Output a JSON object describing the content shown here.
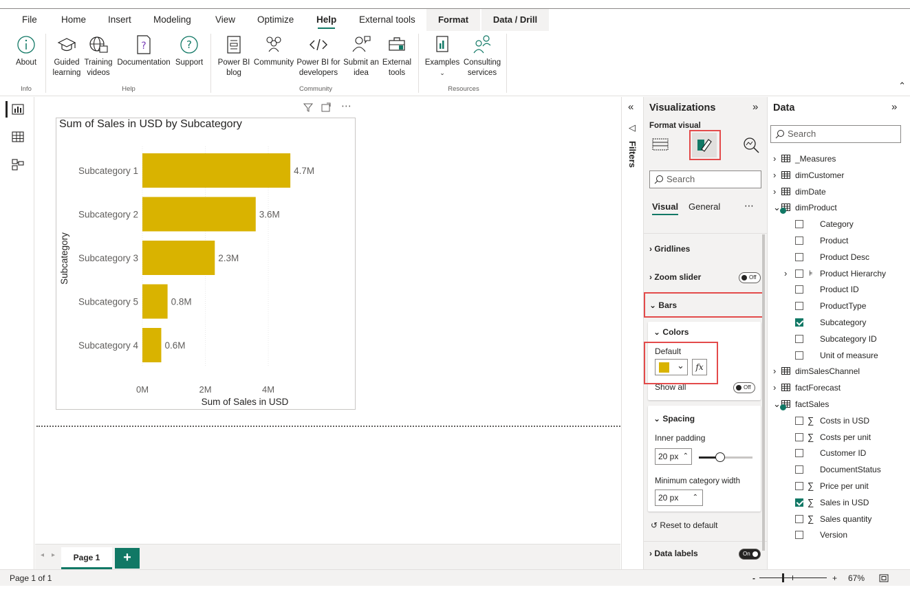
{
  "menu": {
    "tabs": [
      "File",
      "Home",
      "Insert",
      "Modeling",
      "View",
      "Optimize",
      "Help",
      "External tools"
    ],
    "active": "Help",
    "context_tabs": [
      "Format",
      "Data / Drill"
    ]
  },
  "ribbon": {
    "about": "About",
    "guided": "Guided learning",
    "training": "Training videos",
    "documentation": "Documentation",
    "support": "Support",
    "blog": "Power BI blog",
    "community": "Community",
    "developers": "Power BI for developers",
    "submit": "Submit an idea",
    "external": "External tools",
    "examples": "Examples",
    "consulting": "Consulting services",
    "groups": {
      "info": "Info",
      "help": "Help",
      "community": "Community",
      "resources": "Resources"
    }
  },
  "visual": {
    "title": "Sum of Sales in USD by Subcategory"
  },
  "chart_data": {
    "type": "bar",
    "orientation": "horizontal",
    "title": "Sum of Sales in USD by Subcategory",
    "xlabel": "Sum of Sales in USD",
    "ylabel": "Subcategory",
    "categories": [
      "Subcategory 1",
      "Subcategory 2",
      "Subcategory 3",
      "Subcategory 5",
      "Subcategory 4"
    ],
    "values": [
      4.7,
      3.6,
      2.3,
      0.8,
      0.6
    ],
    "data_labels": [
      "4.7M",
      "3.6M",
      "2.3M",
      "0.8M",
      "0.6M"
    ],
    "xticks": [
      0,
      2,
      4
    ],
    "xtick_labels": [
      "0M",
      "2M",
      "4M"
    ],
    "xlim": [
      0,
      5.2
    ],
    "color": "#D9B300",
    "grid": true
  },
  "filters": {
    "label": "Filters"
  },
  "viz": {
    "title": "Visualizations",
    "format_visual": "Format visual",
    "search_placeholder": "Search",
    "tab_visual": "Visual",
    "tab_general": "General",
    "gridlines": "Gridlines",
    "zoom_slider": "Zoom slider",
    "zoom_toggle": "Off",
    "bars": "Bars",
    "colors": "Colors",
    "default": "Default",
    "default_color": "#D9B300",
    "show_all": "Show all",
    "show_all_toggle": "Off",
    "spacing": "Spacing",
    "inner_padding": "Inner padding",
    "inner_padding_value": "20 px",
    "inner_padding_slider": 0.4,
    "min_cat_width": "Minimum category width",
    "min_cat_width_value": "20 px",
    "reset": "Reset to default",
    "data_labels": "Data labels",
    "data_labels_toggle": "On"
  },
  "data": {
    "title": "Data",
    "search_placeholder": "Search",
    "tables": [
      {
        "name": "_Measures"
      },
      {
        "name": "dimCustomer"
      },
      {
        "name": "dimDate"
      },
      {
        "name": "dimProduct",
        "fields": [
          {
            "name": "Category",
            "checked": false
          },
          {
            "name": "Product",
            "checked": false
          },
          {
            "name": "Product Desc",
            "checked": false
          },
          {
            "name": "Product Hierarchy",
            "checked": false,
            "hierarchy": true
          },
          {
            "name": "Product ID",
            "checked": false
          },
          {
            "name": "ProductType",
            "checked": false
          },
          {
            "name": "Subcategory",
            "checked": true
          },
          {
            "name": "Subcategory ID",
            "checked": false
          },
          {
            "name": "Unit of measure",
            "checked": false
          }
        ]
      },
      {
        "name": "dimSalesChannel"
      },
      {
        "name": "factForecast"
      },
      {
        "name": "factSales",
        "fields": [
          {
            "name": "Costs in USD",
            "checked": false,
            "sum": true
          },
          {
            "name": "Costs per unit",
            "checked": false,
            "sum": true
          },
          {
            "name": "Customer ID",
            "checked": false
          },
          {
            "name": "DocumentStatus",
            "checked": false
          },
          {
            "name": "Price per unit",
            "checked": false,
            "sum": true
          },
          {
            "name": "Sales in USD",
            "checked": true,
            "sum": true
          },
          {
            "name": "Sales quantity",
            "checked": false,
            "sum": true
          },
          {
            "name": "Version",
            "checked": false
          }
        ]
      }
    ]
  },
  "pages": {
    "current": "Page 1",
    "add": "+"
  },
  "status": {
    "page": "Page 1 of 1",
    "zoom": "67%",
    "zoom_fraction": 0.35,
    "minus": "-",
    "plus": "+"
  }
}
